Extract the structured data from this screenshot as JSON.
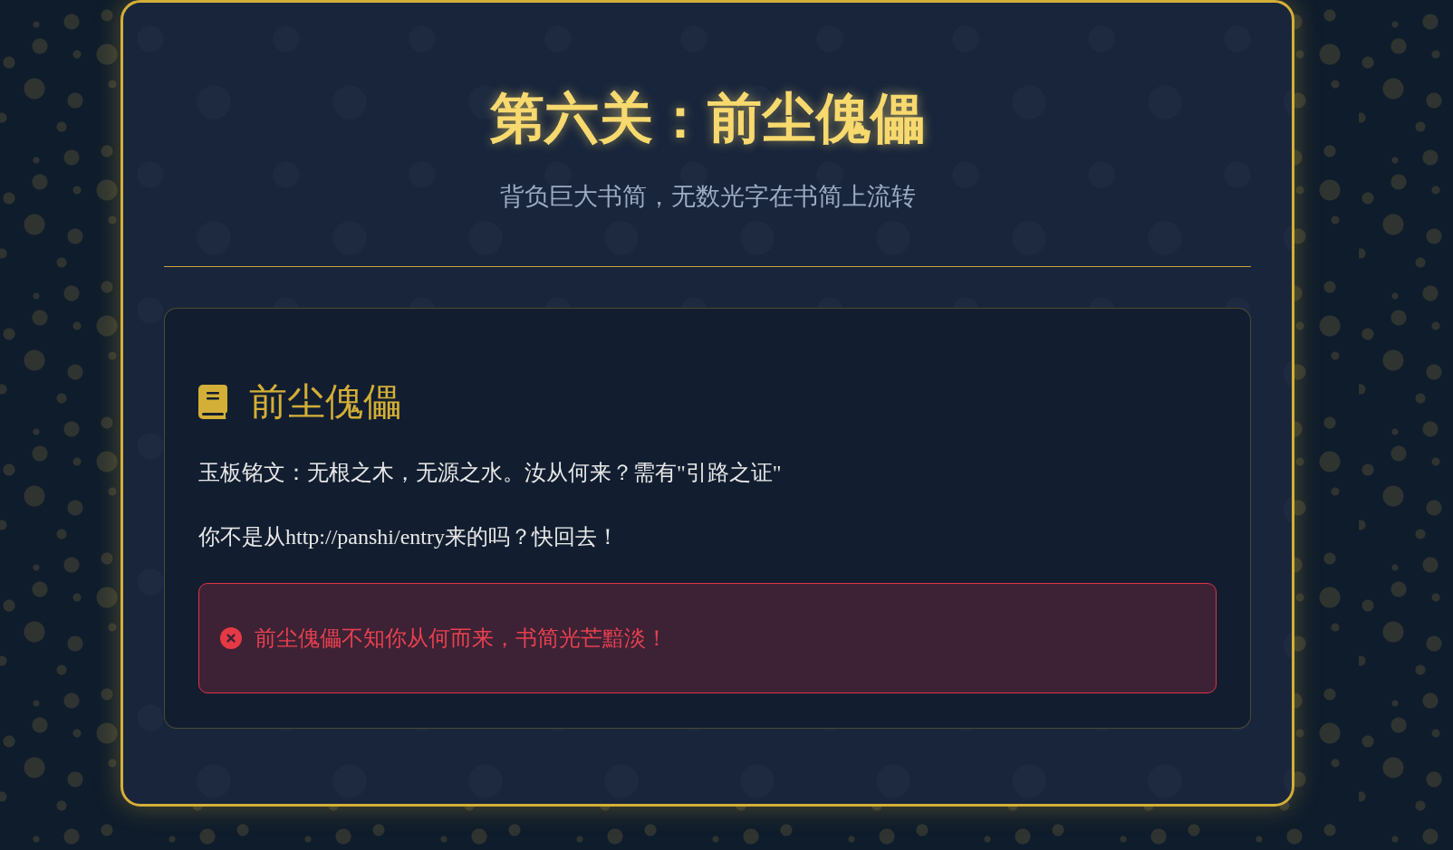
{
  "header": {
    "title": "第六关：前尘傀儡",
    "subtitle": "背负巨大书简，无数光字在书简上流转"
  },
  "panel": {
    "heading": "前尘傀儡",
    "paragraphs": [
      "玉板铭文：无根之木，无源之水。汝从何来？需有\"引路之证\"",
      "你不是从http://panshi/entry来的吗？快回去！"
    ],
    "alert": {
      "kind": "error",
      "text": "前尘傀儡不知你从何而来，书简光芒黯淡！"
    }
  }
}
